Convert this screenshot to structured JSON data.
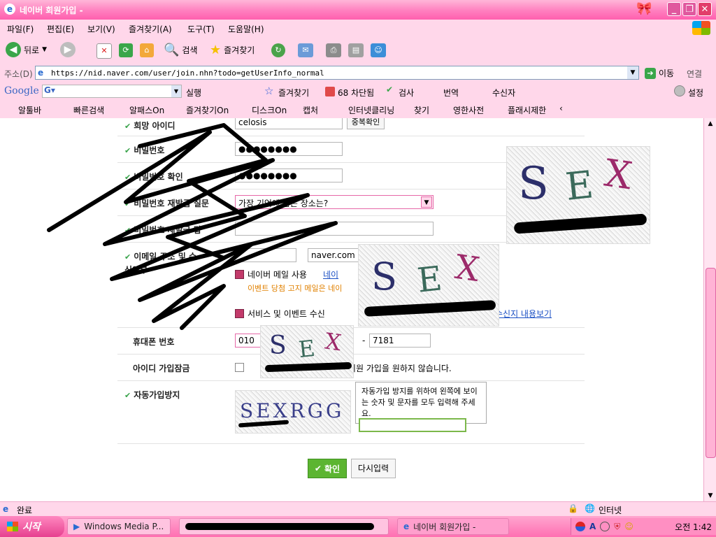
{
  "window": {
    "title": "네이버 회원가입 -"
  },
  "menu": [
    "파일(F)",
    "편집(E)",
    "보기(V)",
    "즐겨찾기(A)",
    "도구(T)",
    "도움말(H)"
  ],
  "toolbar": {
    "back": "뒤로",
    "search": "검색",
    "favorites": "즐겨찾기"
  },
  "address": {
    "label": "주소(D)",
    "url": "https://nid.naver.com/user/join.nhn?todo=getUserInfo_normal",
    "go": "이동",
    "links": "연결"
  },
  "googlebar": {
    "brand": "Google",
    "run": "실행",
    "favorites": "즐겨찾기",
    "blocked": "68 차단됨",
    "check": "검사",
    "translate": "번역",
    "sendto": "수신자",
    "settings": "설정"
  },
  "linkbar": [
    "알툴바",
    "빠른검색",
    "알패스On",
    "즐겨찾기On",
    "디스크On",
    "캡처",
    "인터넷클리닝",
    "찾기",
    "영한사전",
    "플래시제한"
  ],
  "form": {
    "id_label": "희망 아이디",
    "id_value": "celosis",
    "id_check": "중복확인",
    "pw_label": "비밀번호",
    "pw_value": "●●●●●●●●",
    "pw_confirm_label": "비밀번호 확인",
    "pw_confirm_value": "●●●●●●●●",
    "pw_q_label": "비밀번호 재발급 질문",
    "pw_q_value": "가장 기억에 남는 장소는?",
    "pw_a_label": "비밀번호 재발급 답",
    "email_label": "이메일 주소 및 수신여부",
    "email_domain": "naver.com",
    "naver_mail": "네이버 메일 사용",
    "naver_link": "네이",
    "event_note": "이벤트 당첨 고지 메일은 네이",
    "service_check": "서비스 및 이벤트 수신",
    "service_link": "수신지 내용보기",
    "phone_label": "휴대폰 번호",
    "phone_prefix": "010",
    "phone_last": "7181",
    "lock_label": "아이디 가입잠금",
    "lock_text": "회원 가입을 원하지 않습니다.",
    "captcha_label": "자동가입방지",
    "captcha_tip": "자동가입 방지를 위하여 왼쪽에 보이는 숫자 및 문자를 모두 입력해 주세요.",
    "captcha_text": "SEXRGG",
    "confirm": "확인",
    "reset": "다시입력"
  },
  "captcha_overlay": {
    "s": "S",
    "e": "E",
    "x": "X"
  },
  "status": {
    "left": "완료",
    "zone": "인터넷"
  },
  "taskbar": {
    "start": "시작",
    "task1": "Windows Media P...",
    "task2": "네이버 회원가입 -",
    "clock": "오전 1:42"
  },
  "colors": {
    "accent": "#ff5fae",
    "bar": "#ffd7ea",
    "check": "#39a34a",
    "confirm": "#5cb531"
  }
}
